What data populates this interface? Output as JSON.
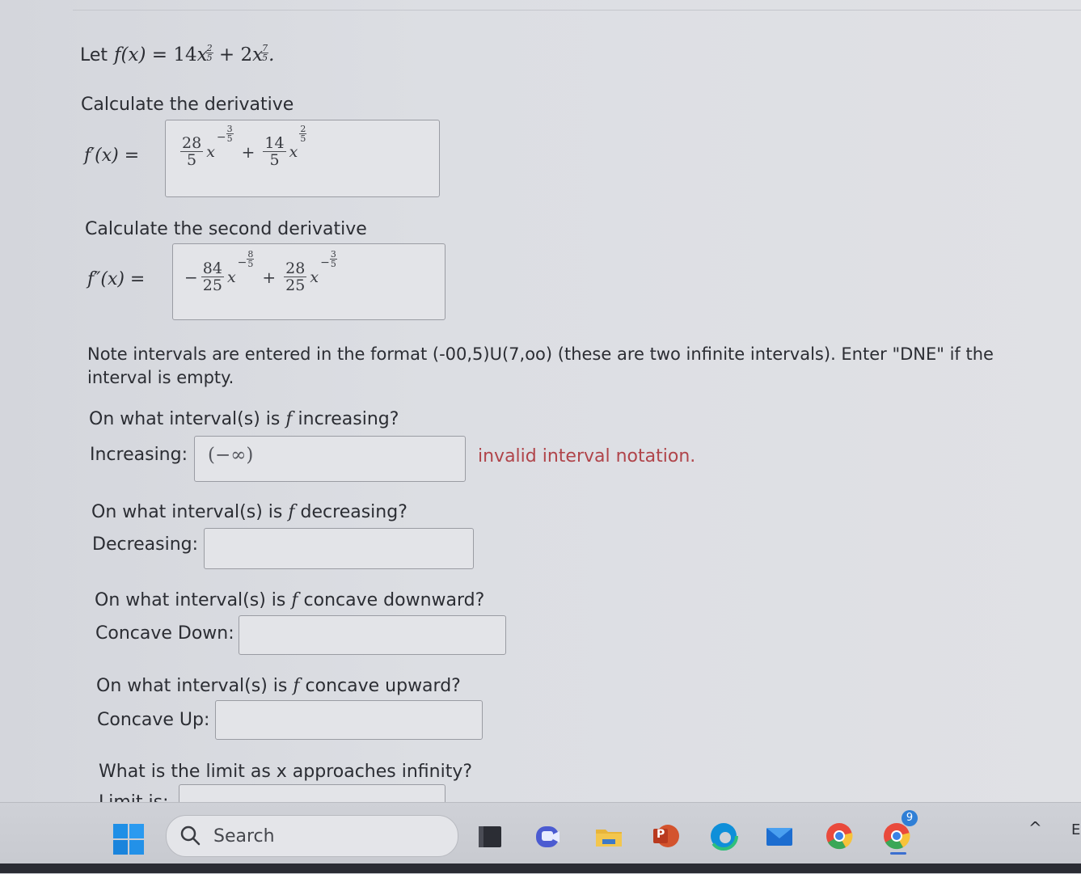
{
  "problem": {
    "let_prefix": "Let",
    "function_def": "f(x) = 14x^(2/5) + 2x^(7/5).",
    "function_coef1": "14",
    "function_coef2": "2",
    "exp1_num": "2",
    "exp1_den": "5",
    "exp2_num": "7",
    "exp2_den": "5"
  },
  "derivative": {
    "prompt": "Calculate the derivative",
    "label": "f′(x) =",
    "answer": {
      "term1_num": "28",
      "term1_den": "5",
      "term1_exp_sign": "−",
      "term1_exp_num": "3",
      "term1_exp_den": "5",
      "plus": "+",
      "term2_num": "14",
      "term2_den": "5",
      "term2_exp_num": "2",
      "term2_exp_den": "5",
      "var": "x"
    }
  },
  "second_derivative": {
    "prompt": "Calculate the second derivative",
    "label": "f″(x) =",
    "answer": {
      "lead_sign": "−",
      "term1_num": "84",
      "term1_den": "25",
      "term1_exp_sign": "−",
      "term1_exp_num": "8",
      "term1_exp_den": "5",
      "plus": "+",
      "term2_num": "28",
      "term2_den": "25",
      "term2_exp_sign": "−",
      "term2_exp_num": "3",
      "term2_exp_den": "5",
      "var": "x"
    }
  },
  "note": {
    "line1": "Note intervals are entered in the format (-00,5)U(7,oo) (these are two infinite intervals). Enter \"DNE\" if the",
    "line2": "interval is empty."
  },
  "increasing": {
    "question_prefix": "On what interval(s) is",
    "question_var": "f",
    "question_suffix": "increasing?",
    "label": "Increasing:",
    "value": "(−∞)",
    "error": "invalid interval notation."
  },
  "decreasing": {
    "question_prefix": "On what interval(s) is",
    "question_var": "f",
    "question_suffix": "decreasing?",
    "label": "Decreasing:",
    "value": ""
  },
  "concave_down": {
    "question_prefix": "On what interval(s) is",
    "question_var": "f",
    "question_suffix": "concave downward?",
    "label": "Concave Down:",
    "value": ""
  },
  "concave_up": {
    "question_prefix": "On what interval(s) is",
    "question_var": "f",
    "question_suffix": "concave upward?",
    "label": "Concave Up:",
    "value": ""
  },
  "limit": {
    "question": "What is the limit as x approaches infinity?",
    "label": "Limit is:",
    "value": ""
  },
  "taskbar": {
    "search_placeholder": "Search",
    "chrome_badge": "9",
    "powerpoint_letter": "P",
    "tray_chevron": "^",
    "tray_text": "E",
    "icons": [
      "start-icon",
      "search-icon",
      "file-explorer-dark-icon",
      "teams-icon",
      "folder-icon",
      "powerpoint-icon",
      "edge-icon",
      "mail-icon",
      "chrome-icon",
      "chrome-profile-icon"
    ]
  },
  "colors": {
    "error": "#b0444a",
    "windows_blue": "#1f8fe6",
    "chrome_badge": "#2f7fd6"
  }
}
